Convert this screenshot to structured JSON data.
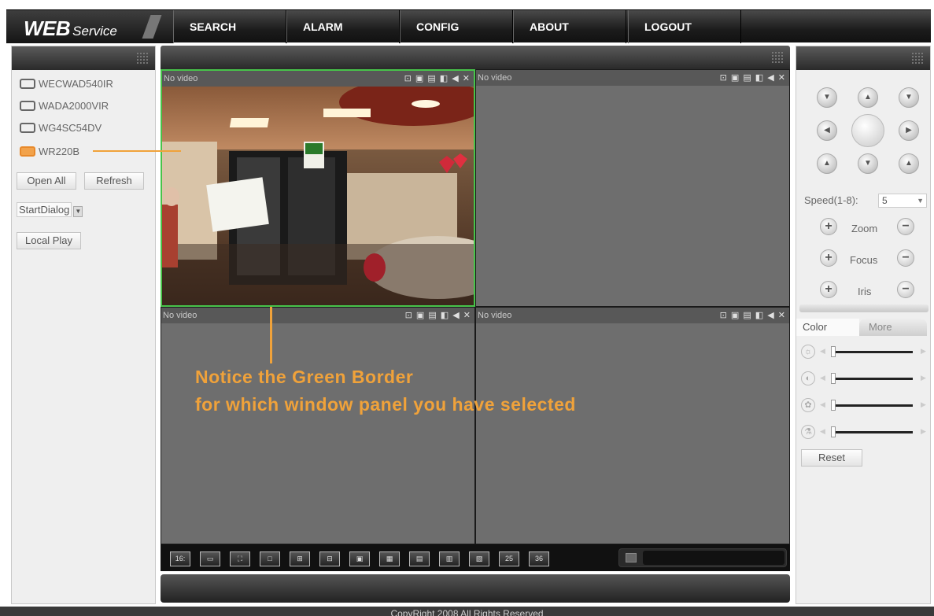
{
  "app": {
    "logo_main": "WEB",
    "logo_sub": "Service"
  },
  "nav": [
    {
      "label": "SEARCH"
    },
    {
      "label": "ALARM"
    },
    {
      "label": "CONFIG"
    },
    {
      "label": "ABOUT"
    },
    {
      "label": "LOGOUT"
    }
  ],
  "devices": [
    {
      "name": "WECWAD540IR"
    },
    {
      "name": "WADA2000VIR"
    },
    {
      "name": "WG4SC54DV"
    },
    {
      "name": "WR220B"
    }
  ],
  "left_buttons": {
    "open_all": "Open All",
    "refresh": "Refresh",
    "start_dialog": "StartDialog",
    "local_play": "Local Play"
  },
  "video_panes": [
    {
      "status": "No video",
      "tools": "⊡ ▣ ▤ ◧ ◀ ✕"
    },
    {
      "status": "No video",
      "tools": "⊡ ▣ ▤ ◧ ◀ ✕"
    },
    {
      "status": "No video",
      "tools": "⊡ ▣ ▤ ◧ ◀ ✕"
    },
    {
      "status": "No video",
      "tools": "⊡ ▣ ▤ ◧ ◀ ✕"
    }
  ],
  "annotation": {
    "line1": "Notice the Green Border",
    "line2": "for which window panel you have selected"
  },
  "ptz": {
    "speed_label": "Speed(1-8):",
    "speed_value": "5",
    "zoom_label": "Zoom",
    "focus_label": "Focus",
    "iris_label": "Iris"
  },
  "color_tabs": {
    "color": "Color",
    "more": "More"
  },
  "reset_label": "Reset",
  "footer": "CopyRight 2008 All Rights Reserved",
  "colors": {
    "selected_border": "#47c44a",
    "annotation": "#f0a23a",
    "active_device": "#e8892a"
  }
}
